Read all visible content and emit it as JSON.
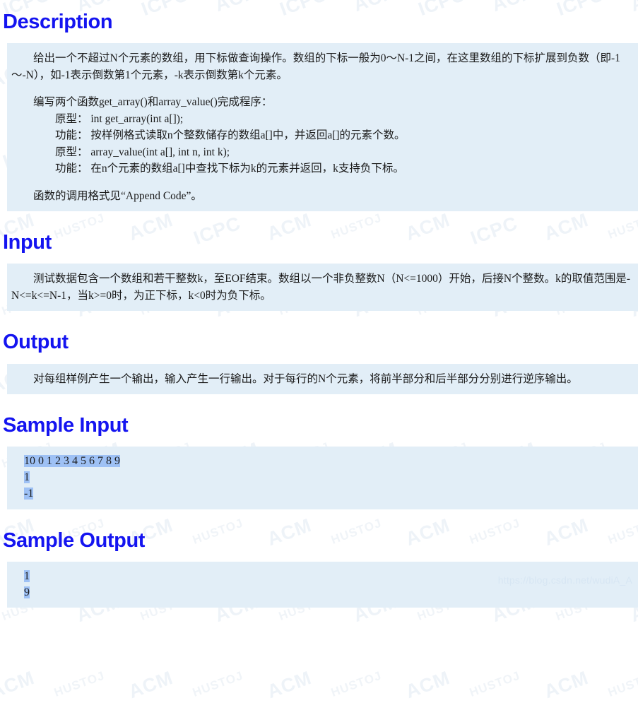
{
  "page": {
    "url_watermark": "https://blog.csdn.net/wudiA_A",
    "background_watermarks": [
      "HUSTOJ",
      "ACM",
      "ICPC"
    ],
    "heading_color": "#1414f0",
    "panel_background": "#e2eef7",
    "selection_color": "#9ec1f5"
  },
  "sections": {
    "description": {
      "title": "Description",
      "paragraphs": [
        "给出一个不超过N个元素的数组，用下标做查询操作。数组的下标一般为0～N-1之间，在这里数组的下标扩展到负数（即-1～-N），如-1表示倒数第1个元素，-k表示倒数第k个元素。",
        "编写两个函数get_array()和array_value()完成程序：",
        "原型： int get_array(int a[]);",
        "功能： 按样例格式读取n个整数储存的数组a[]中，并返回a[]的元素个数。",
        "原型： array_value(int a[], int n, int k);",
        "功能： 在n个元素的数组a[]中查找下标为k的元素并返回，k支持负下标。",
        "函数的调用格式见“Append Code”。"
      ]
    },
    "input": {
      "title": "Input",
      "paragraphs": [
        "测试数据包含一个数组和若干整数k，至EOF结束。数组以一个非负整数N（N<=1000）开始，后接N个整数。k的取值范围是-N<=k<=N-1，当k>=0时，为正下标，k<0时为负下标。"
      ]
    },
    "output": {
      "title": "Output",
      "paragraphs": [
        "对每组样例产生一个输出，输入产生一行输出。对于每行的N个元素，将前半部分和后半部分分别进行逆序输出。"
      ]
    },
    "sample_input": {
      "title": "Sample Input",
      "lines": [
        "10 0 1 2 3 4 5 6 7 8 9",
        "1",
        "-1"
      ]
    },
    "sample_output": {
      "title": "Sample Output",
      "lines": [
        "1",
        "9"
      ]
    }
  }
}
